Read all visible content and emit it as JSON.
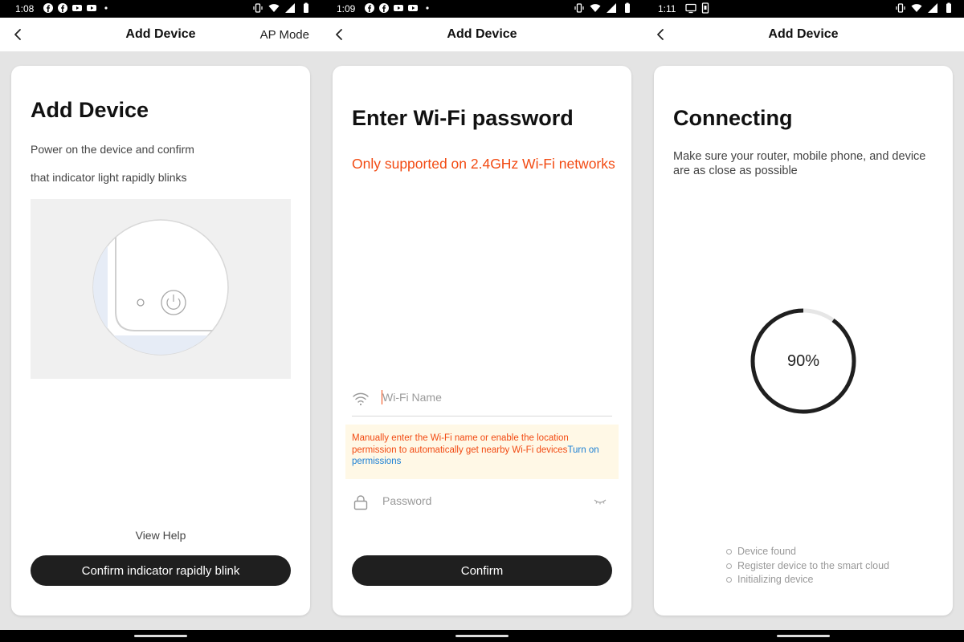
{
  "screens": [
    {
      "status": {
        "time": "1:08"
      },
      "header": {
        "title": "Add Device",
        "right": "AP Mode"
      },
      "card": {
        "title": "Add Device",
        "line1": "Power on the device and confirm",
        "line2": "that indicator light rapidly blinks",
        "help": "View Help",
        "button": "Confirm indicator rapidly blink"
      }
    },
    {
      "status": {
        "time": "1:09"
      },
      "header": {
        "title": "Add Device"
      },
      "card": {
        "title": "Enter Wi-Fi password",
        "note": "Only supported on 2.4GHz Wi-Fi networks",
        "wifi_placeholder": "Wi-Fi Name",
        "warning": "Manually enter the Wi-Fi name or enable the location permission to automatically get nearby Wi-Fi devices",
        "warning_link": "Turn on permissions",
        "password_placeholder": "Password",
        "button": "Confirm"
      }
    },
    {
      "status": {
        "time": "1:11"
      },
      "header": {
        "title": "Add Device"
      },
      "card": {
        "title": "Connecting",
        "line1": "Make sure your router, mobile phone, and device",
        "line2": "are as close as possible",
        "progress": 0.9,
        "progress_label": "90%",
        "steps": [
          "Device found",
          "Register device to the smart cloud",
          "Initializing device"
        ]
      }
    }
  ],
  "colors": {
    "accent_orange": "#f24a12",
    "link_blue": "#1a7fd4",
    "button_dark": "#1f1f1f"
  }
}
